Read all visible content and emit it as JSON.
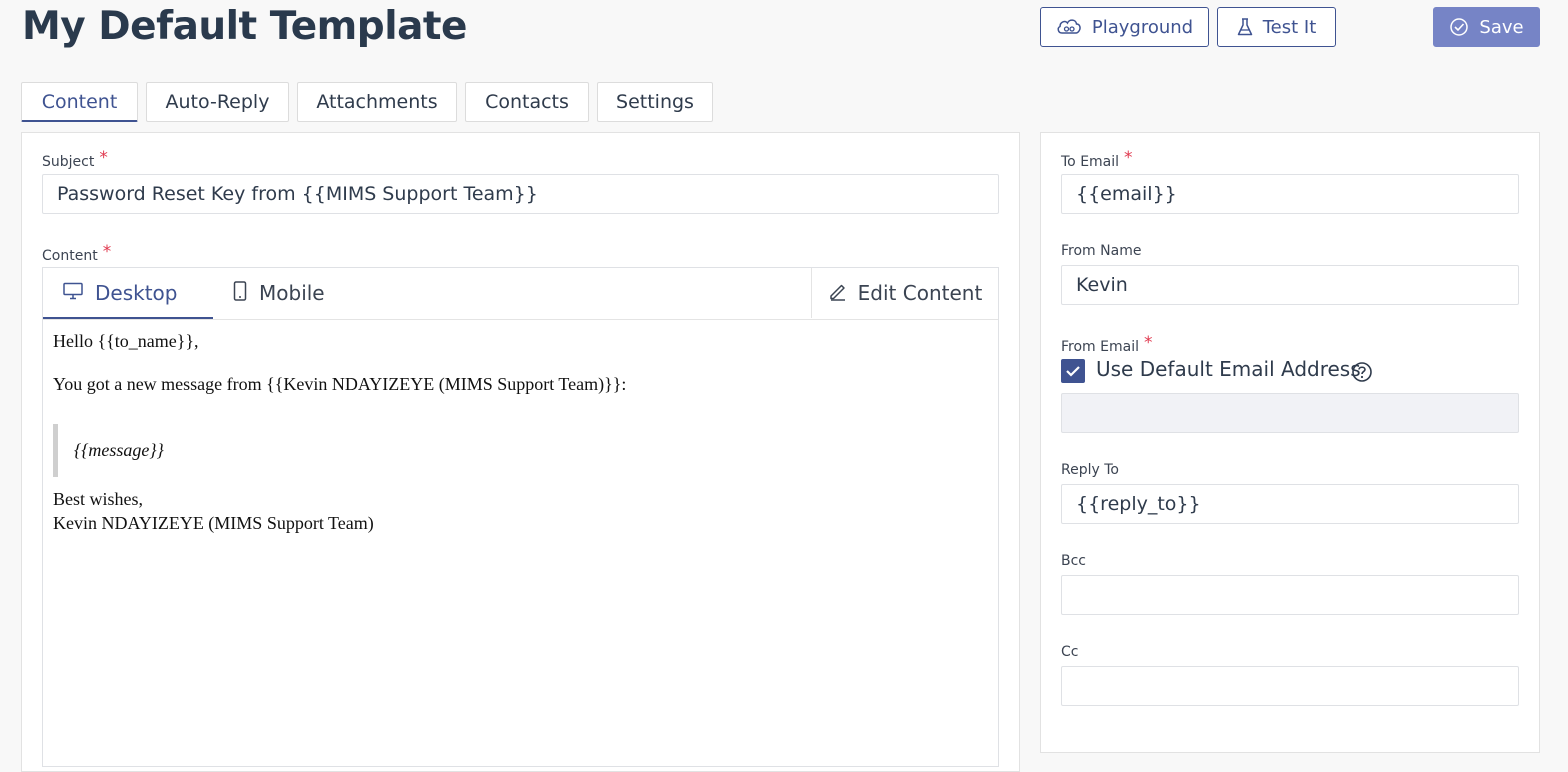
{
  "header": {
    "title": "My Default Template",
    "playground_label": "Playground",
    "test_label": "Test It",
    "save_label": "Save"
  },
  "tabs": [
    {
      "label": "Content",
      "active": true
    },
    {
      "label": "Auto-Reply"
    },
    {
      "label": "Attachments"
    },
    {
      "label": "Contacts"
    },
    {
      "label": "Settings"
    }
  ],
  "content_panel": {
    "subject_label": "Subject",
    "subject_value": "Password Reset Key from {{MIMS Support Team}}",
    "content_label": "Content",
    "editor": {
      "desktop_label": "Desktop",
      "mobile_label": "Mobile",
      "edit_label": "Edit Content",
      "greeting": "Hello {{to_name}},",
      "intro": "You got a new message from {{Kevin NDAYIZEYE (MIMS Support Team)}}:",
      "quote": "{{message}}",
      "signoff": "Best wishes,",
      "signature": "Kevin NDAYIZEYE (MIMS Support Team)"
    }
  },
  "side_panel": {
    "to_email_label": "To Email",
    "to_email_value": "{{email}}",
    "from_name_label": "From Name",
    "from_name_value": "Kevin",
    "from_email_label": "From Email",
    "use_default_label": "Use Default Email Address",
    "use_default_checked": true,
    "from_email_value": "",
    "reply_to_label": "Reply To",
    "reply_to_value": "{{reply_to}}",
    "bcc_label": "Bcc",
    "bcc_value": "",
    "cc_label": "Cc",
    "cc_value": ""
  },
  "required_mark": "*",
  "colors": {
    "accent": "#3f5391",
    "primary_button": "#7684c6",
    "required": "#e0394f"
  }
}
